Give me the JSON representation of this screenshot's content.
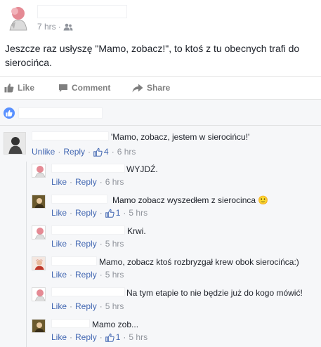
{
  "post": {
    "time": "7 hrs",
    "text": "Jeszcze raz usłyszę \"Mamo, zobacz!\", to ktoś z tu obecnych trafi do sierocińca."
  },
  "actions": {
    "like": "Like",
    "comment": "Comment",
    "share": "Share"
  },
  "colors": {
    "link": "#4267b2",
    "like_bubble": "#5890ff",
    "meta_gray": "#90949c"
  },
  "comments": [
    {
      "text": "'Mamo, zobacz, jestem w sierocińcu!'",
      "like": "Unlike",
      "reply": "Reply",
      "likes": "4",
      "time": "6 hrs"
    },
    {
      "text": "WYJDŹ.",
      "like": "Like",
      "reply": "Reply",
      "likes": "",
      "time": "6 hrs"
    },
    {
      "text": "Mamo zobacz wyszedłem z sierocinca 🙂",
      "like": "Like",
      "reply": "Reply",
      "likes": "1",
      "time": "5 hrs"
    },
    {
      "text": "Krwi.",
      "like": "Like",
      "reply": "Reply",
      "likes": "",
      "time": "5 hrs"
    },
    {
      "text": "Mamo, zobacz ktoś rozbryzgał krew obok sierocińca:)",
      "like": "Like",
      "reply": "Reply",
      "likes": "",
      "time": "5 hrs"
    },
    {
      "text": "Na tym etapie to nie będzie już do kogo mówić!",
      "like": "Like",
      "reply": "Reply",
      "likes": "",
      "time": "5 hrs"
    },
    {
      "text": "Mamo zob...",
      "like": "Like",
      "reply": "Reply",
      "likes": "1",
      "time": "5 hrs"
    }
  ]
}
